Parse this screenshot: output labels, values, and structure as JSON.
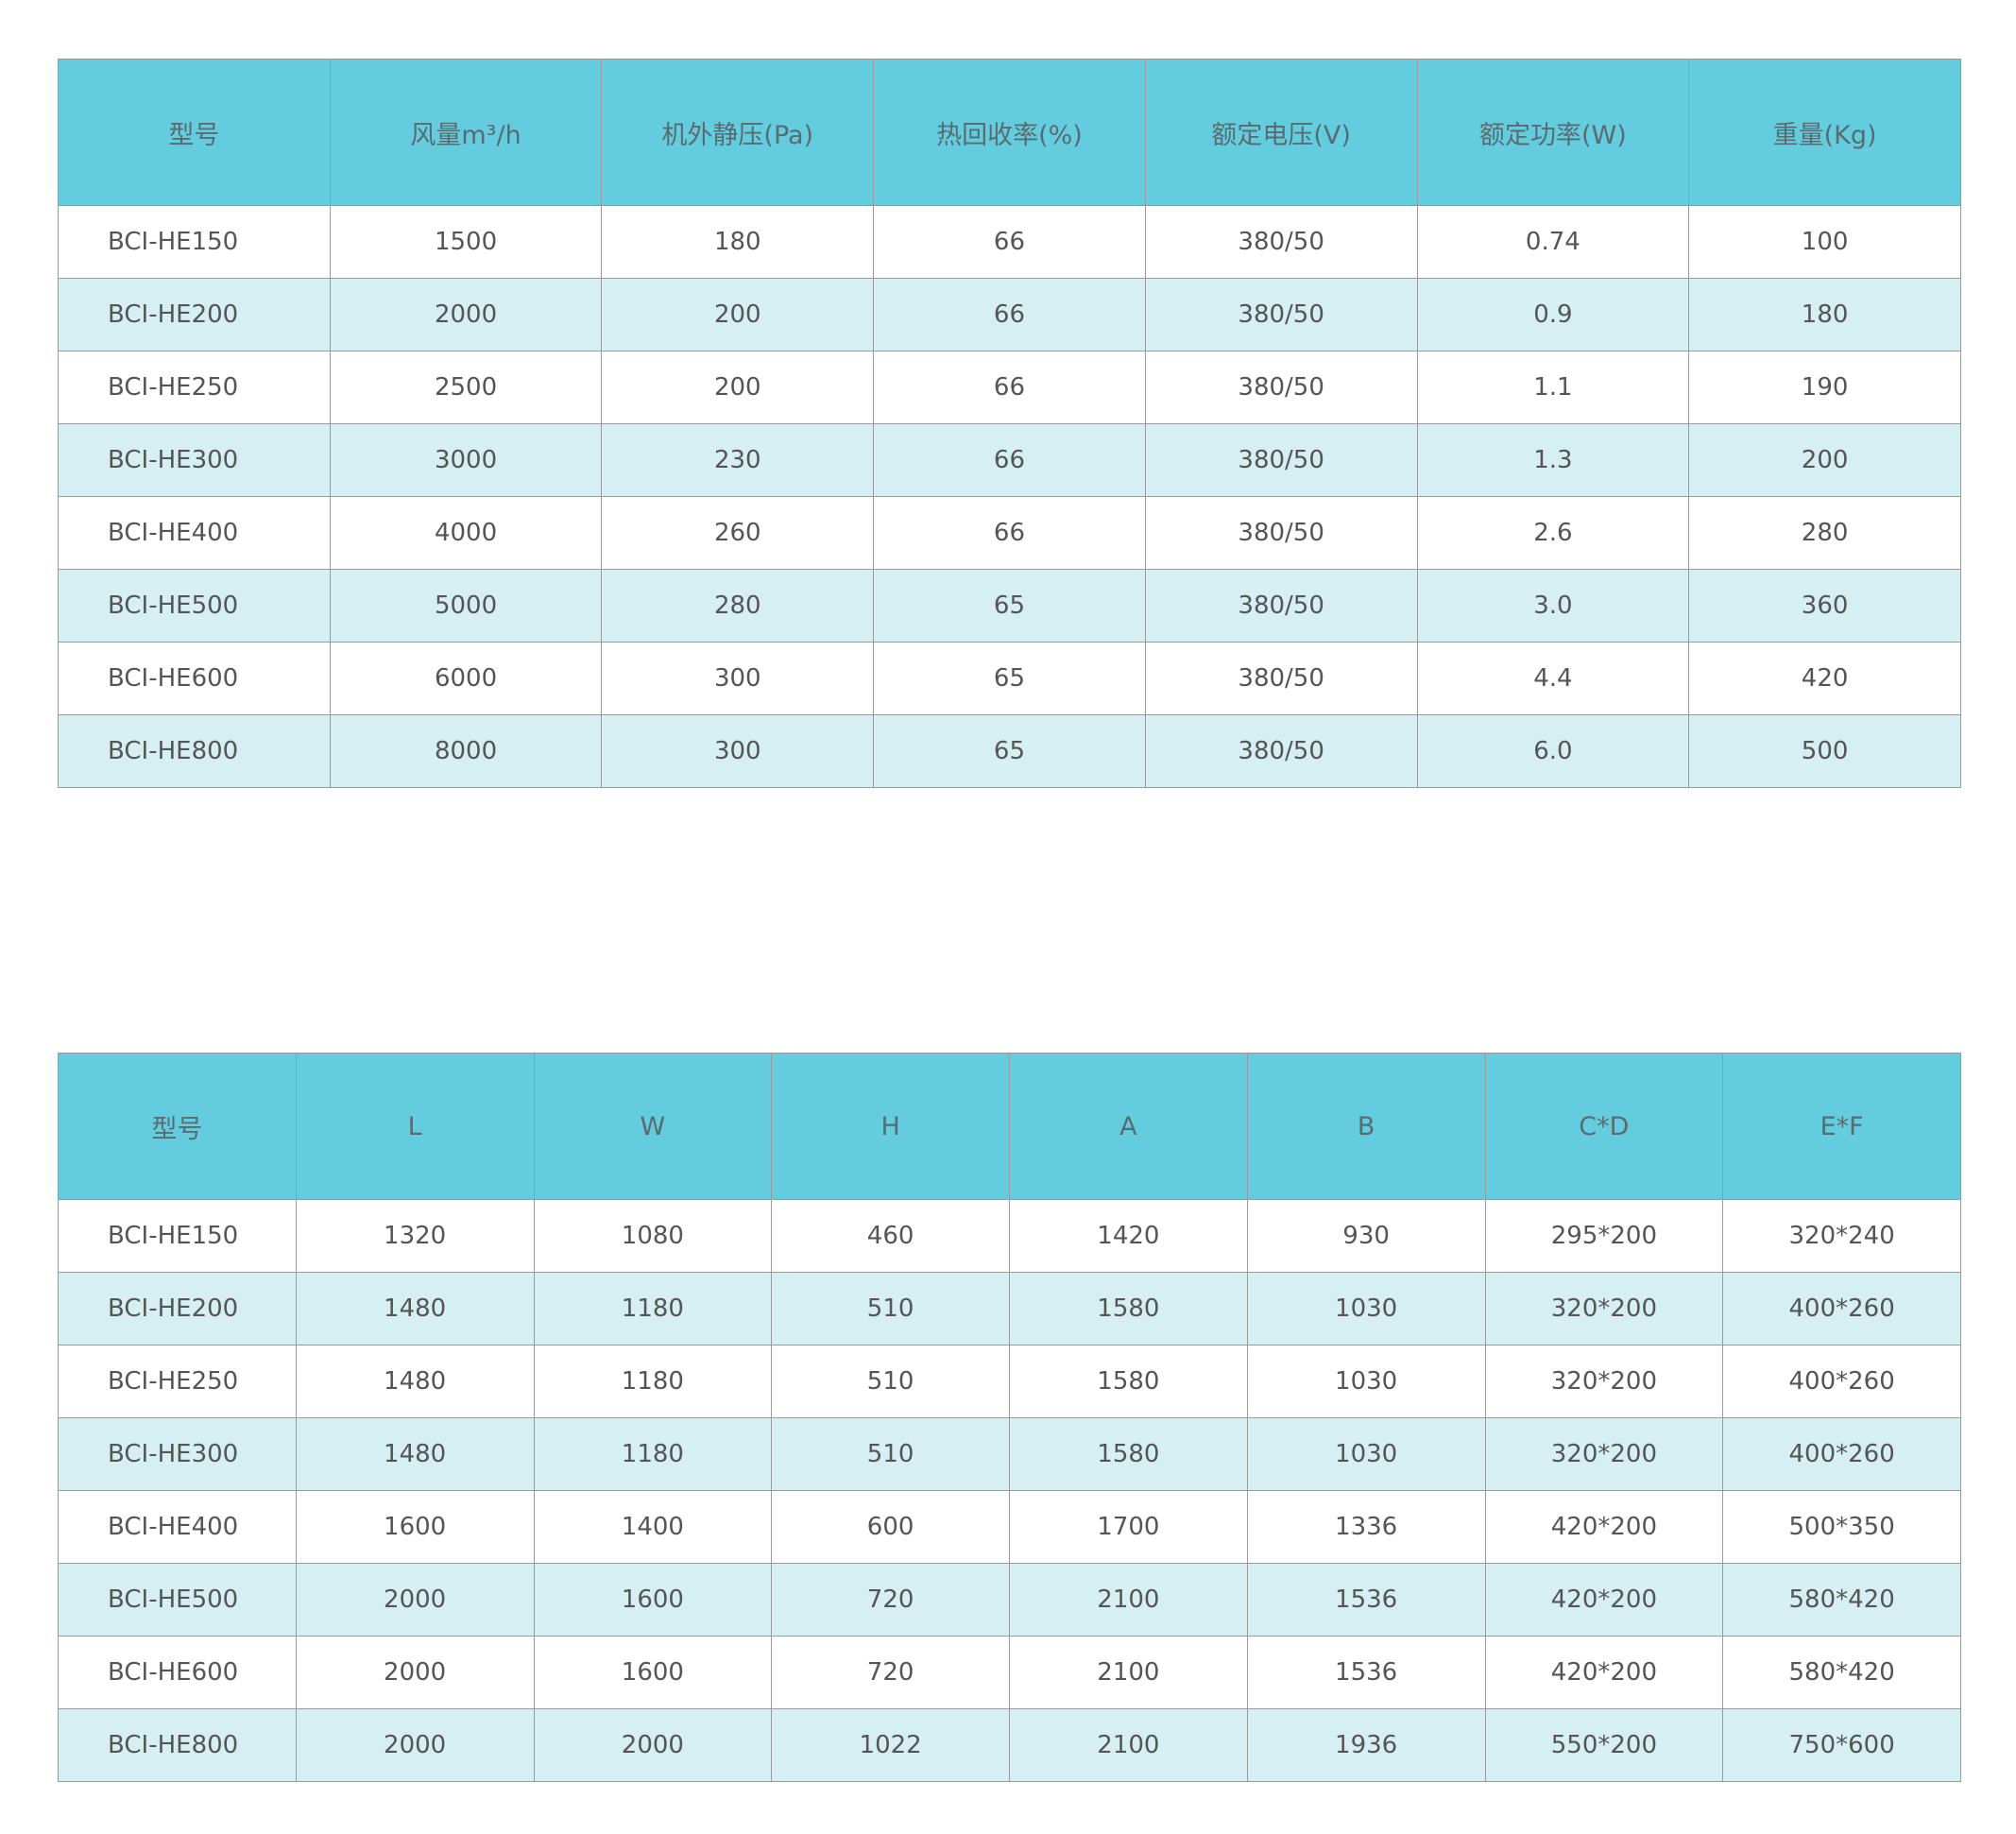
{
  "performance_table": {
    "headers": [
      "型号",
      "风量m³/h",
      "机外静压(Pa)",
      "热回收率(%)",
      "额定电压(V)",
      "额定功率(W)",
      "重量(Kg)"
    ],
    "rows": [
      [
        "BCI-HE150",
        "1500",
        "180",
        "66",
        "380/50",
        "0.74",
        "100"
      ],
      [
        "BCI-HE200",
        "2000",
        "200",
        "66",
        "380/50",
        "0.9",
        "180"
      ],
      [
        "BCI-HE250",
        "2500",
        "200",
        "66",
        "380/50",
        "1.1",
        "190"
      ],
      [
        "BCI-HE300",
        "3000",
        "230",
        "66",
        "380/50",
        "1.3",
        "200"
      ],
      [
        "BCI-HE400",
        "4000",
        "260",
        "66",
        "380/50",
        "2.6",
        "280"
      ],
      [
        "BCI-HE500",
        "5000",
        "280",
        "65",
        "380/50",
        "3.0",
        "360"
      ],
      [
        "BCI-HE600",
        "6000",
        "300",
        "65",
        "380/50",
        "4.4",
        "420"
      ],
      [
        "BCI-HE800",
        "8000",
        "300",
        "65",
        "380/50",
        "6.0",
        "500"
      ]
    ]
  },
  "dimension_table": {
    "headers": [
      "型号",
      "L",
      "W",
      "H",
      "A",
      "B",
      "C*D",
      "E*F"
    ],
    "rows": [
      [
        "BCI-HE150",
        "1320",
        "1080",
        "460",
        "1420",
        "930",
        "295*200",
        "320*240"
      ],
      [
        "BCI-HE200",
        "1480",
        "1180",
        "510",
        "1580",
        "1030",
        "320*200",
        "400*260"
      ],
      [
        "BCI-HE250",
        "1480",
        "1180",
        "510",
        "1580",
        "1030",
        "320*200",
        "400*260"
      ],
      [
        "BCI-HE300",
        "1480",
        "1180",
        "510",
        "1580",
        "1030",
        "320*200",
        "400*260"
      ],
      [
        "BCI-HE400",
        "1600",
        "1400",
        "600",
        "1700",
        "1336",
        "420*200",
        "500*350"
      ],
      [
        "BCI-HE500",
        "2000",
        "1600",
        "720",
        "2100",
        "1536",
        "420*200",
        "580*420"
      ],
      [
        "BCI-HE600",
        "2000",
        "1600",
        "720",
        "2100",
        "1536",
        "420*200",
        "580*420"
      ],
      [
        "BCI-HE800",
        "2000",
        "2000",
        "1022",
        "2100",
        "1936",
        "550*200",
        "750*600"
      ]
    ]
  },
  "colors": {
    "header_background": "#63cddf",
    "alternate_row_background": "#d5eff3",
    "border": "#9a9a9a"
  }
}
